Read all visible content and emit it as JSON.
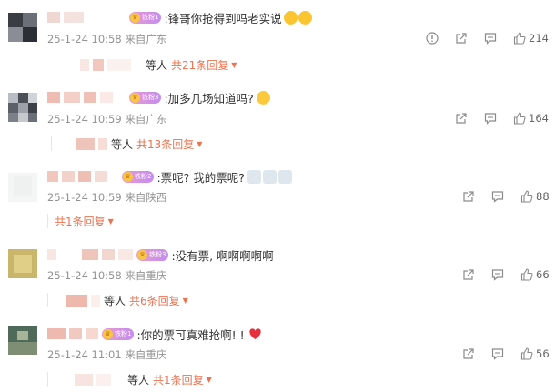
{
  "comments": [
    {
      "text": ":锋哥你抢得到吗老实说",
      "emoji": [
        "laughing-crying-emoji",
        "laughing-crying-emoji"
      ],
      "meta": "25-1-24 10:58 来自广东",
      "likes": "214",
      "reply_others": "等人",
      "reply_count": "共21条回复",
      "has_report": true
    },
    {
      "text": ":加多几场知道吗?",
      "emoji": [
        "smile-emoji"
      ],
      "meta": "25-1-24 10:59 来自广东",
      "likes": "164",
      "reply_others": "等人",
      "reply_count": "共13条回复",
      "has_report": false
    },
    {
      "text": ":票呢? 我的票呢?",
      "emoji": [
        "microphone-emoji",
        "microphone-emoji",
        "microphone-emoji"
      ],
      "meta": "25-1-24 10:59 来自陕西",
      "likes": "88",
      "reply_others": "",
      "reply_count": "共1条回复",
      "has_report": false
    },
    {
      "text": ":没有票, 啊啊啊啊啊",
      "emoji": [],
      "meta": "25-1-24 10:58 来自重庆",
      "likes": "66",
      "reply_others": "等人",
      "reply_count": "共6条回复",
      "has_report": false
    },
    {
      "text": ":你的票可真难抢啊! !",
      "emoji": [
        "red-heart-emoji"
      ],
      "meta": "25-1-24 11:01 来自重庆",
      "likes": "56",
      "reply_others": "等人",
      "reply_count": "共1条回复",
      "has_report": false
    }
  ],
  "icons": {
    "report": "report-icon",
    "forward": "forward-icon",
    "comment": "comment-icon",
    "like": "thumbs-up-icon"
  },
  "colors": {
    "reply_accent": "#eb7350",
    "meta_gray": "#939393"
  }
}
